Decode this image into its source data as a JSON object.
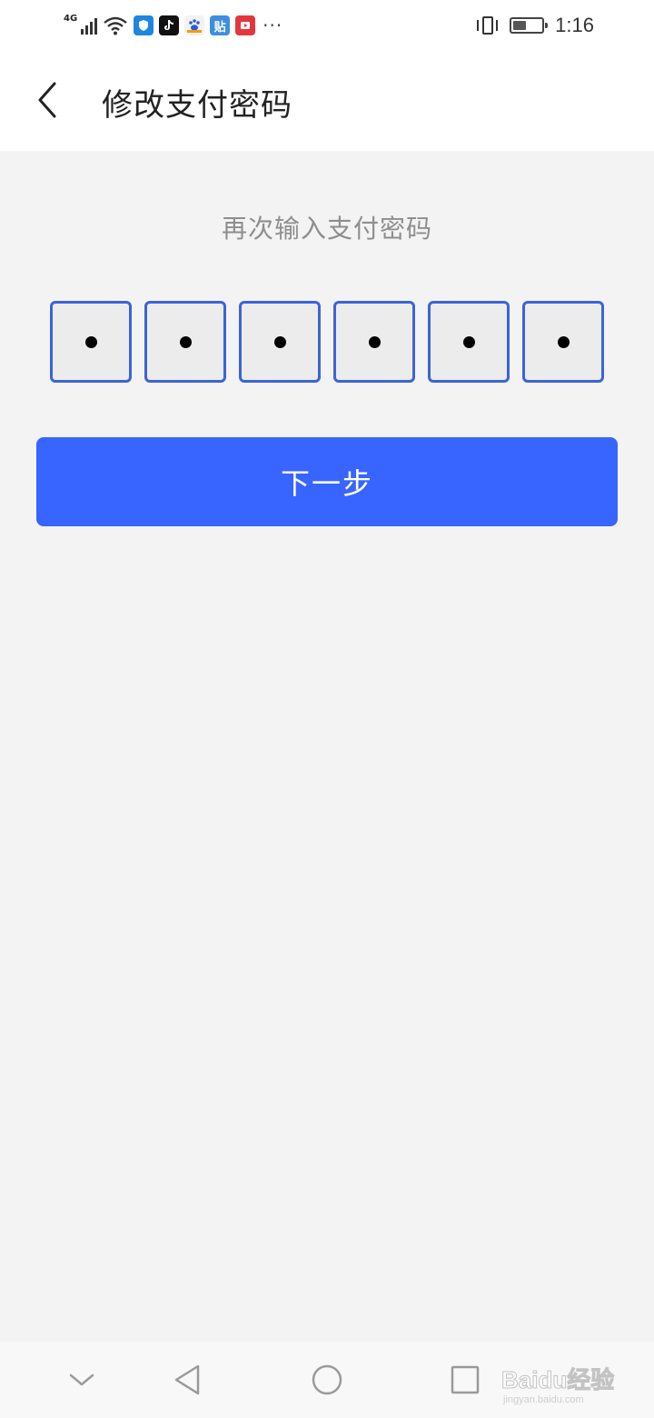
{
  "status_bar": {
    "network": "4G",
    "time": "1:16",
    "more": "···",
    "apps": [
      {
        "icon": "shield-app-icon",
        "color": "#1f86e0",
        "glyph": ""
      },
      {
        "icon": "tiktok-app-icon",
        "color": "#111111",
        "glyph": "♪"
      },
      {
        "icon": "baidu-app-icon",
        "color": "#f2f2f2",
        "glyph": ""
      },
      {
        "icon": "tieba-app-icon",
        "color": "#3e8ee0",
        "glyph": "贴"
      },
      {
        "icon": "video-app-icon",
        "color": "#e2373f",
        "glyph": ""
      }
    ]
  },
  "header": {
    "title": "修改支付密码"
  },
  "main": {
    "prompt": "再次输入支付密码",
    "pin_digits_filled": 6,
    "pin_length": 6,
    "next_label": "下一步"
  },
  "watermark": {
    "text": "Baidu经验",
    "sub": "jingyan.baidu.com"
  },
  "colors": {
    "primary": "#3865ff",
    "pin_border": "#3b64d6",
    "background": "#f3f3f3"
  }
}
